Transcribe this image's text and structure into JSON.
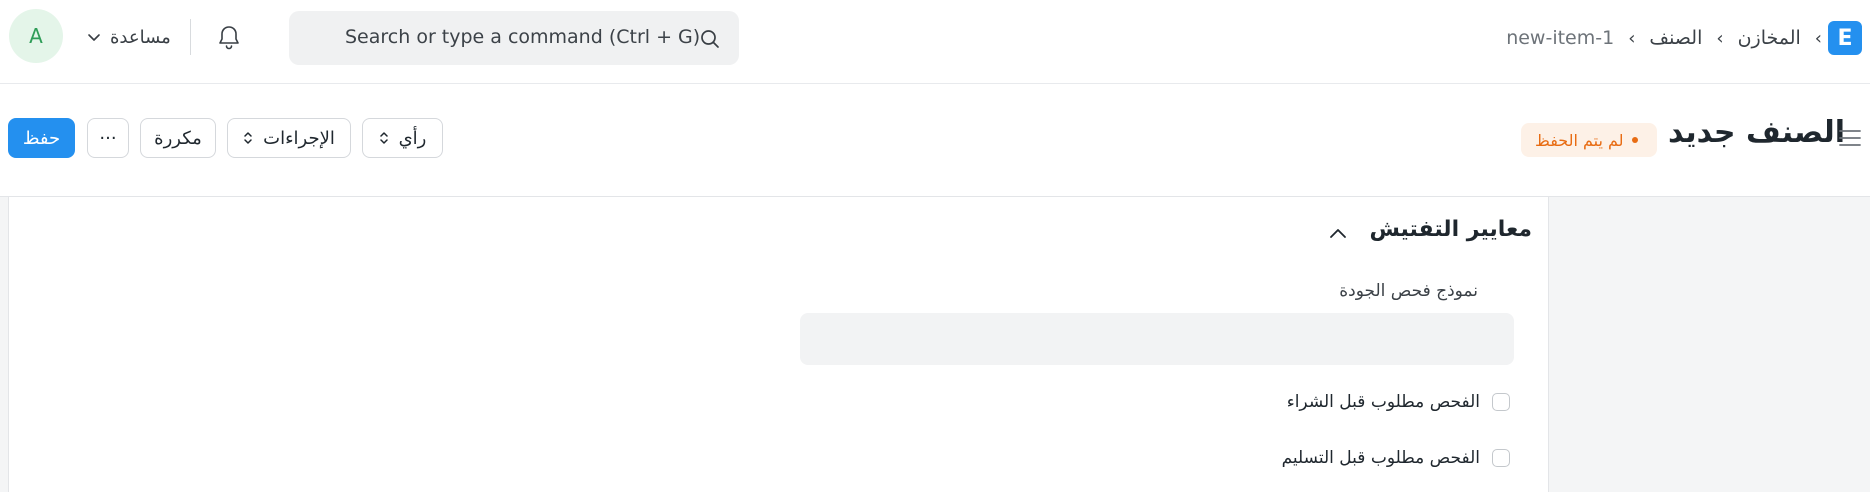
{
  "navbar": {
    "avatar_letter": "A",
    "help_label": "مساعدة",
    "search_placeholder": "Search or type a command (Ctrl + G)",
    "breadcrumbs": [
      "new-item-1",
      "الصنف",
      "المخازن"
    ],
    "logo_letter": "E"
  },
  "page": {
    "title": "الصنف جديد",
    "status_badge": "لم يتم الحفظ",
    "buttons": {
      "save": "حفظ",
      "more": "···",
      "duplicate": "مكررة",
      "actions": "الإجراءات",
      "view": "رأي"
    }
  },
  "section": {
    "title": "معايير التفتيش",
    "field_label": "نموذج فحص الجودة",
    "field_value": "",
    "checkboxes": [
      {
        "label": "الفحص مطلوب قبل الشراء",
        "checked": false
      },
      {
        "label": "الفحص مطلوب قبل التسليم",
        "checked": false
      }
    ]
  },
  "colors": {
    "primary": "#2490ef",
    "badge_text": "#e86c13",
    "badge_bg": "#fdf1e7",
    "avatar_text": "#2f9d58",
    "avatar_bg": "#e4f5e9"
  }
}
